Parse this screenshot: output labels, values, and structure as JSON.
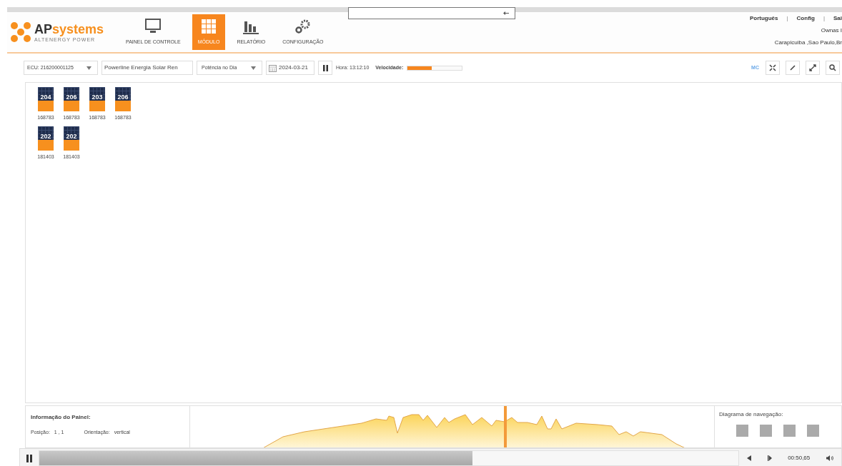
{
  "header": {
    "brand_ap": "AP",
    "brand_rest": "systems",
    "tagline": "ALTENERGY POWER",
    "nav": [
      {
        "label": "PAINEL DE CONTROLE",
        "selected": false
      },
      {
        "label": "MÓDULO",
        "selected": true
      },
      {
        "label": "RELATÓRIO",
        "selected": false
      },
      {
        "label": "CONFIGURAÇÃO",
        "selected": false
      }
    ],
    "links": [
      {
        "kind": "link",
        "text": "Português"
      },
      {
        "kind": "sep",
        "text": "|"
      },
      {
        "kind": "link",
        "text": "Config"
      },
      {
        "kind": "sep",
        "text": "|"
      },
      {
        "kind": "link",
        "text": "Sai"
      }
    ],
    "user": "Ownas I",
    "location": "Carapicuiba ,Sao Paulo,Br"
  },
  "toolbar": {
    "ecu": "ECU: 216200001125",
    "system": "Powerline Energia Solar Ren",
    "mode": "Potência no Dia",
    "date": "2024-03-21",
    "hour": "Hora: 13:12:10",
    "speed_label": "Velocidade:",
    "speed": {
      "level": 0.45
    },
    "mc": "MC"
  },
  "panels": [
    [
      {
        "value": "204",
        "id": "168783"
      },
      {
        "value": "206",
        "id": "168783"
      },
      {
        "value": "203",
        "id": "168783"
      },
      {
        "value": "206",
        "id": "168783"
      }
    ],
    [
      {
        "value": "202",
        "id": "181403"
      },
      {
        "value": "202",
        "id": "181403"
      }
    ]
  ],
  "info": {
    "title": "Informação do Painel:",
    "fields": [
      {
        "label": "Posição:",
        "value": "1 , 1"
      },
      {
        "label": "Orientação:",
        "value": "vertical"
      }
    ]
  },
  "navigation": {
    "title": "Diagrama de navegação:"
  },
  "player": {
    "progress": {
      "level": 0.62
    },
    "time": "00:50,65"
  }
}
